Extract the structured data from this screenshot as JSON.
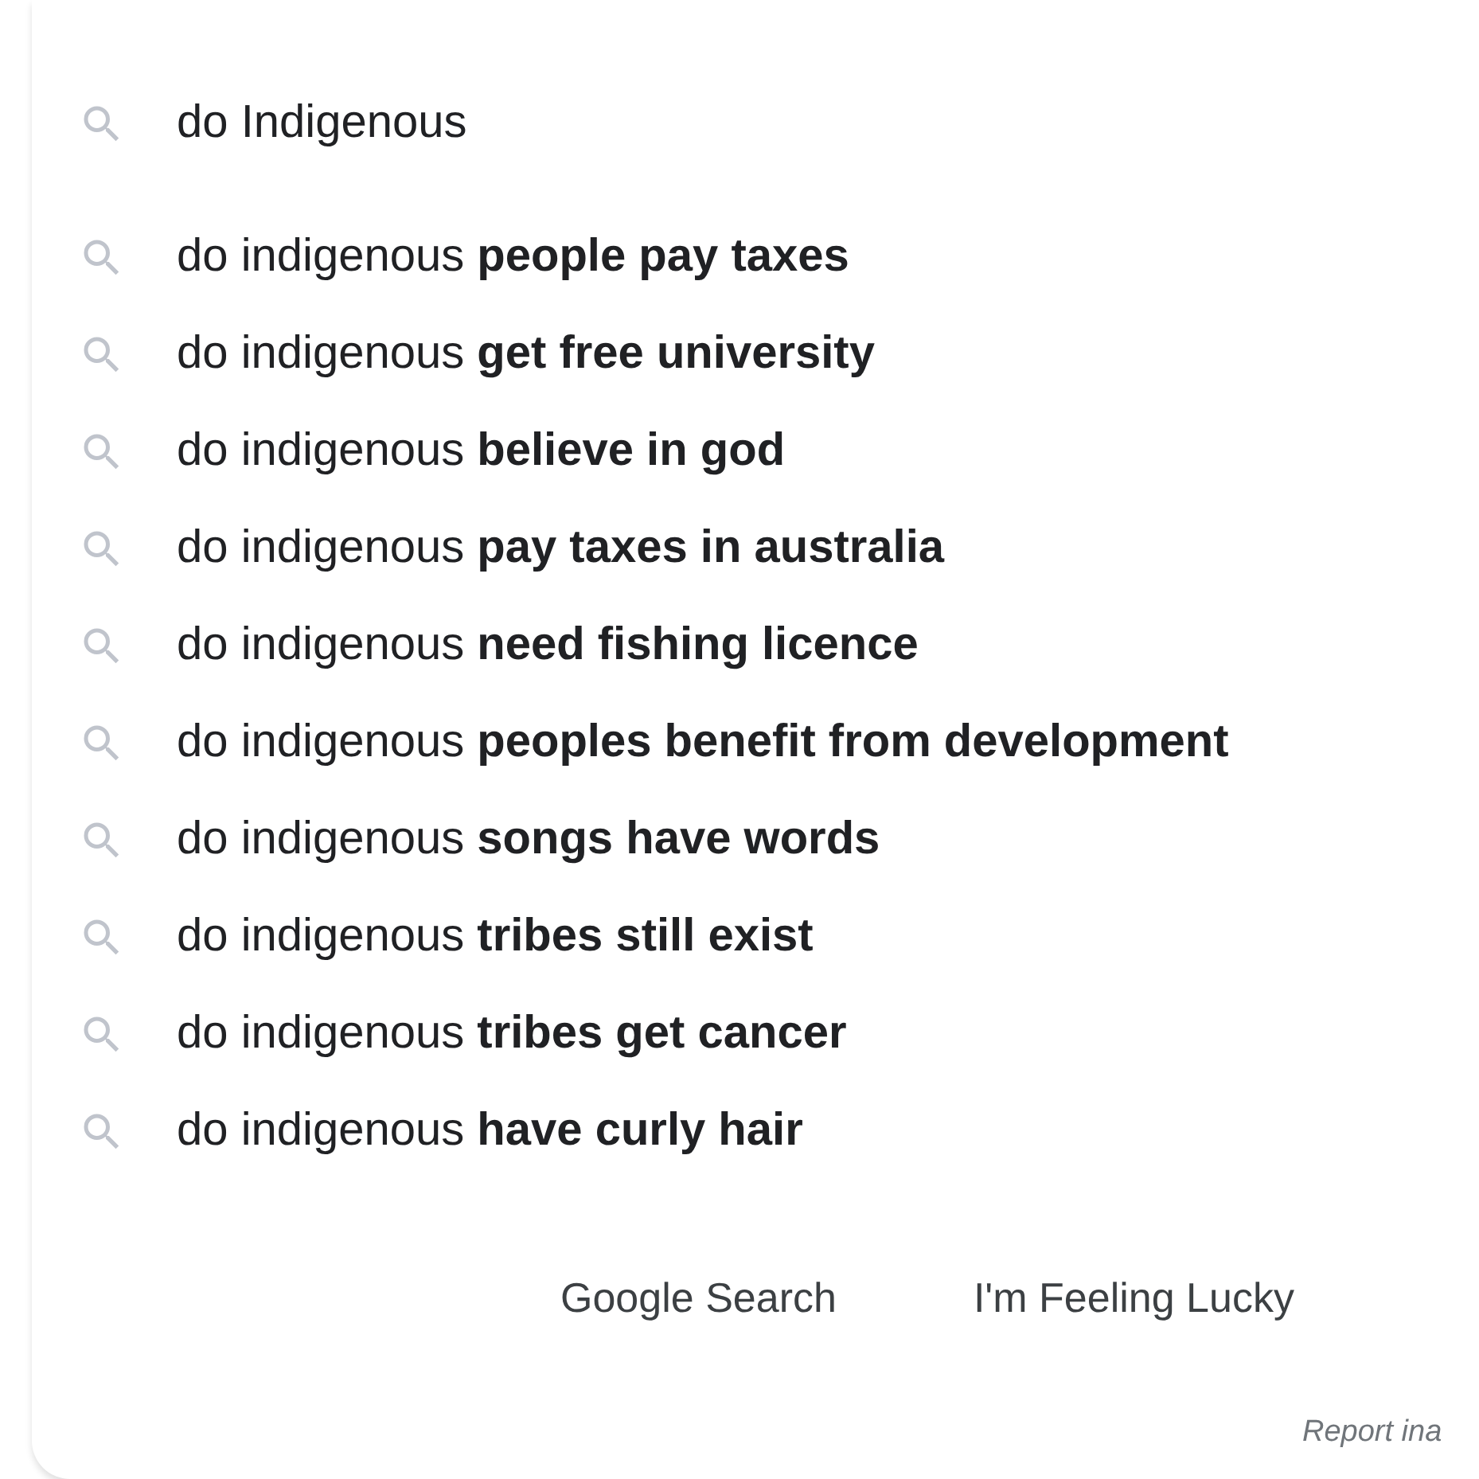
{
  "search": {
    "value": "do Indigenous"
  },
  "suggestions": [
    "do indigenous **people pay taxes**",
    "do indigenous **get free university**",
    "do indigenous **believe in god**",
    "do indigenous **pay taxes in australia**",
    "do indigenous **need fishing licence**",
    "do indigenous **peoples benefit from development**",
    "do indigenous **songs have words**",
    "do indigenous **tribes still exist**",
    "do indigenous **tribes get cancer**",
    "do indigenous **have curly hair**"
  ],
  "buttons": [
    "Google Search",
    "I'm Feeling Lucky"
  ],
  "report_link": "Report ina"
}
